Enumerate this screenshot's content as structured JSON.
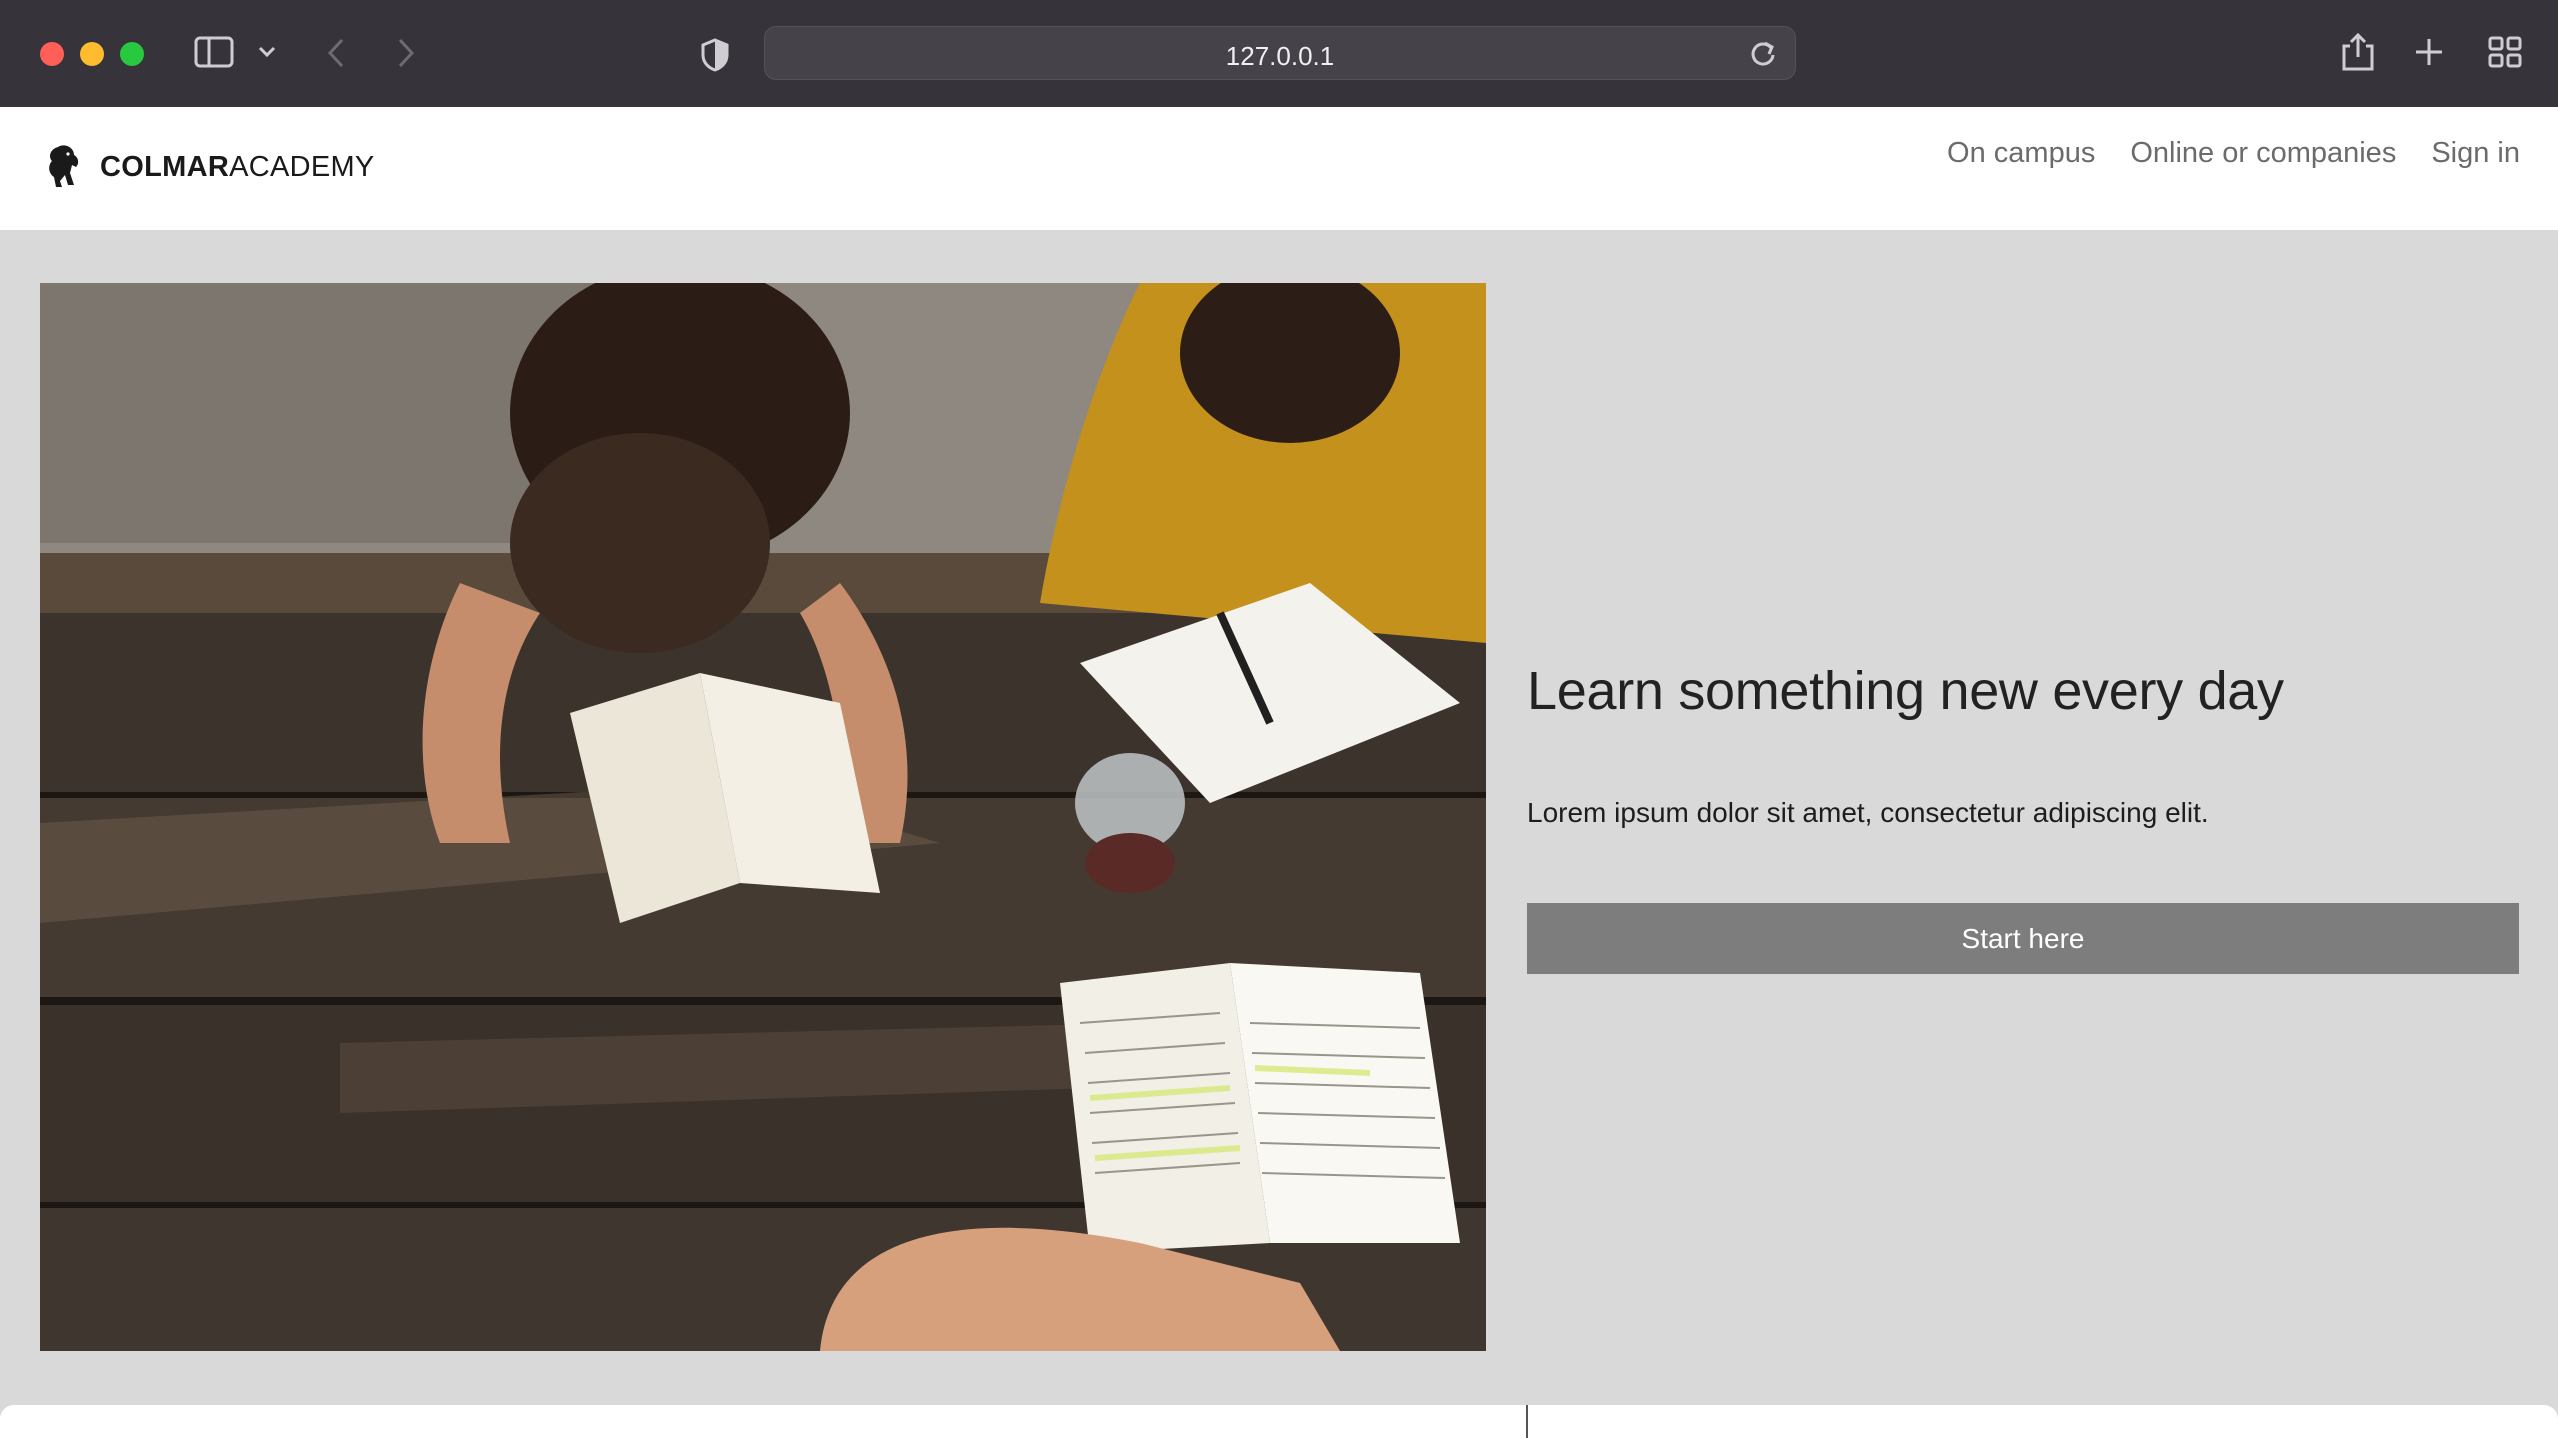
{
  "browser": {
    "url": "127.0.0.1",
    "icons": [
      "sidebar-toggle-icon",
      "chevron-down-icon",
      "back-icon",
      "forward-icon",
      "shield-icon",
      "reload-icon",
      "share-icon",
      "plus-icon",
      "tab-overview-icon"
    ]
  },
  "header": {
    "brand_bold": "COLMAR",
    "brand_light": "ACADEMY",
    "logo_icon": "lion-icon",
    "nav": [
      {
        "label": "On campus"
      },
      {
        "label": "Online or companies"
      },
      {
        "label": "Sign in"
      }
    ]
  },
  "hero": {
    "image_subject": "students-reading-photo",
    "title": "Learn something new every day",
    "text": "Lorem ipsum dolor sit amet, consectetur adipiscing elit.",
    "cta": "Start here"
  },
  "colors": {
    "chrome": "#37333a",
    "page_bg": "#d9d9d9",
    "button": "#7d7d7d"
  }
}
